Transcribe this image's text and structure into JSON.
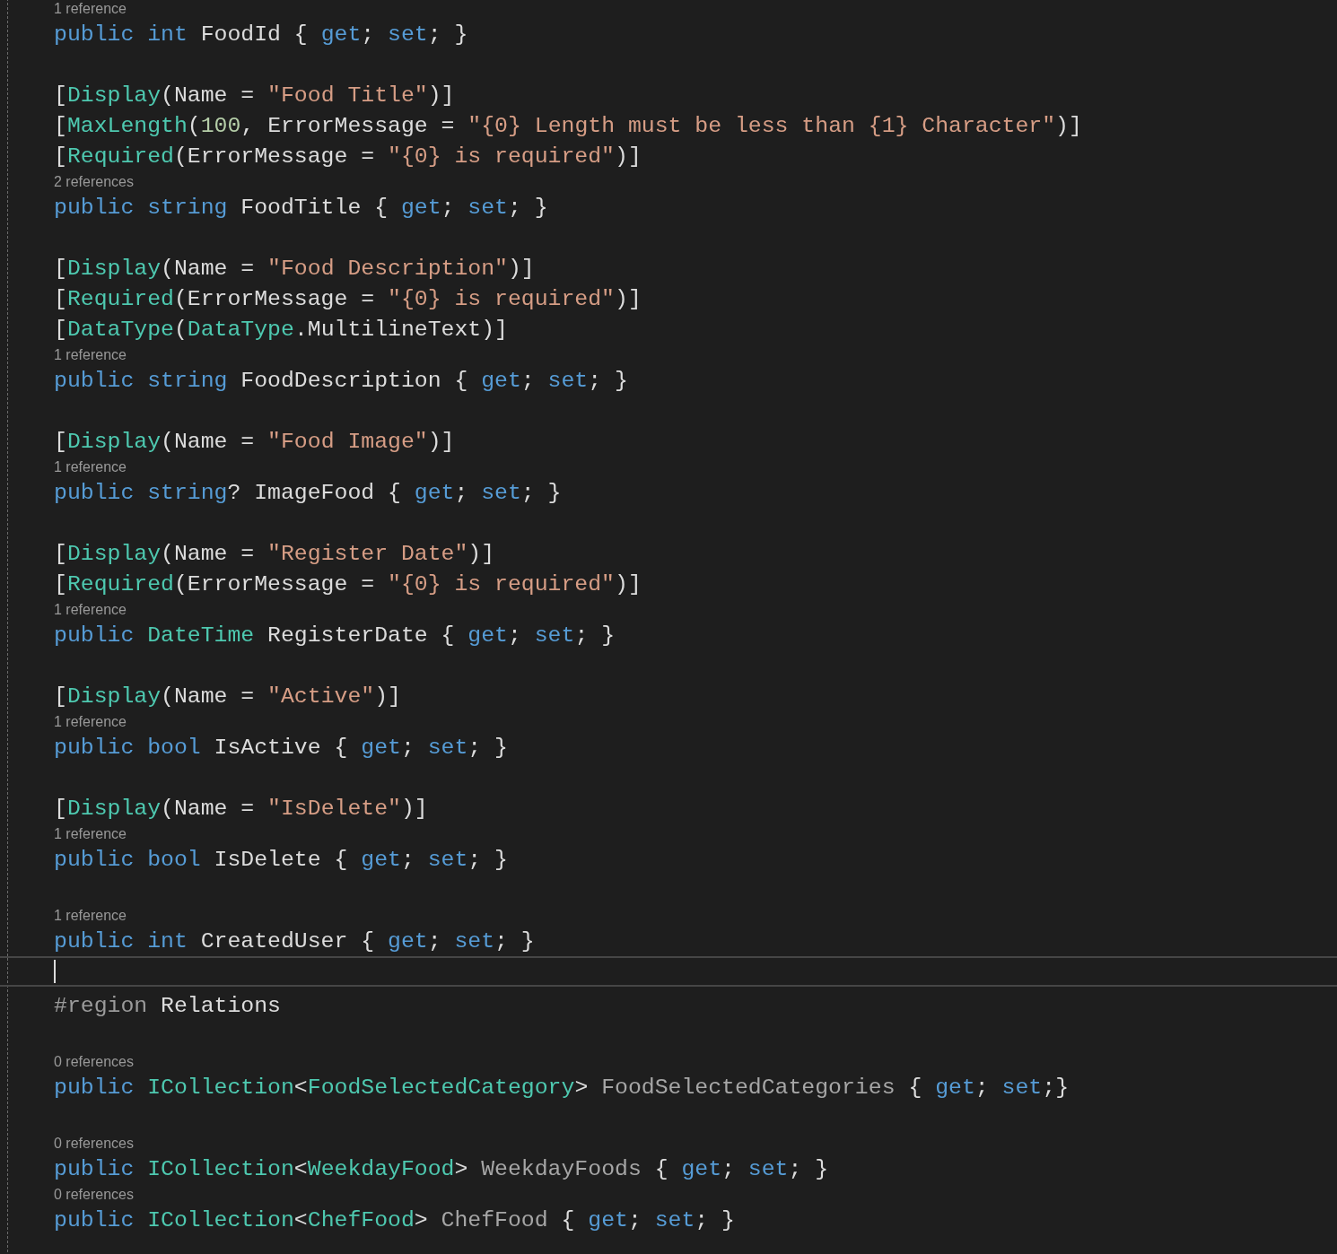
{
  "editor": {
    "lines": [
      {
        "kind": "lens",
        "text": "1 reference"
      },
      {
        "kind": "code",
        "tokens": [
          {
            "kind": "kw",
            "text": "public int"
          },
          {
            "kind": "p",
            "text": " FoodId { "
          },
          {
            "kind": "kw",
            "text": "get"
          },
          {
            "kind": "p",
            "text": "; "
          },
          {
            "kind": "kw",
            "text": "set"
          },
          {
            "kind": "p",
            "text": "; }"
          }
        ]
      },
      {
        "kind": "blank"
      },
      {
        "kind": "code",
        "tokens": [
          {
            "kind": "p",
            "text": "["
          },
          {
            "kind": "attr",
            "text": "Display"
          },
          {
            "kind": "p",
            "text": "(Name = "
          },
          {
            "kind": "str",
            "text": "\"Food Title\""
          },
          {
            "kind": "p",
            "text": ")]"
          }
        ]
      },
      {
        "kind": "code",
        "tokens": [
          {
            "kind": "p",
            "text": "["
          },
          {
            "kind": "attr",
            "text": "MaxLength"
          },
          {
            "kind": "p",
            "text": "("
          },
          {
            "kind": "num",
            "text": "100"
          },
          {
            "kind": "p",
            "text": ", ErrorMessage = "
          },
          {
            "kind": "str",
            "text": "\"{0} Length must be less than {1} Character\""
          },
          {
            "kind": "p",
            "text": ")]"
          }
        ]
      },
      {
        "kind": "code",
        "tokens": [
          {
            "kind": "p",
            "text": "["
          },
          {
            "kind": "attr",
            "text": "Required"
          },
          {
            "kind": "p",
            "text": "(ErrorMessage = "
          },
          {
            "kind": "str",
            "text": "\"{0} is required\""
          },
          {
            "kind": "p",
            "text": ")]"
          }
        ]
      },
      {
        "kind": "lens",
        "text": "2 references"
      },
      {
        "kind": "code",
        "tokens": [
          {
            "kind": "kw",
            "text": "public string"
          },
          {
            "kind": "p",
            "text": " FoodTitle { "
          },
          {
            "kind": "kw",
            "text": "get"
          },
          {
            "kind": "p",
            "text": "; "
          },
          {
            "kind": "kw",
            "text": "set"
          },
          {
            "kind": "p",
            "text": "; }"
          }
        ]
      },
      {
        "kind": "blank"
      },
      {
        "kind": "code",
        "tokens": [
          {
            "kind": "p",
            "text": "["
          },
          {
            "kind": "attr",
            "text": "Display"
          },
          {
            "kind": "p",
            "text": "(Name = "
          },
          {
            "kind": "str",
            "text": "\"Food Description\""
          },
          {
            "kind": "p",
            "text": ")]"
          }
        ]
      },
      {
        "kind": "code",
        "tokens": [
          {
            "kind": "p",
            "text": "["
          },
          {
            "kind": "attr",
            "text": "Required"
          },
          {
            "kind": "p",
            "text": "(ErrorMessage = "
          },
          {
            "kind": "str",
            "text": "\"{0} is required\""
          },
          {
            "kind": "p",
            "text": ")]"
          }
        ]
      },
      {
        "kind": "code",
        "tokens": [
          {
            "kind": "p",
            "text": "["
          },
          {
            "kind": "attr",
            "text": "DataType"
          },
          {
            "kind": "p",
            "text": "("
          },
          {
            "kind": "attr",
            "text": "DataType"
          },
          {
            "kind": "p",
            "text": ".MultilineText)]"
          }
        ]
      },
      {
        "kind": "lens",
        "text": "1 reference"
      },
      {
        "kind": "code",
        "tokens": [
          {
            "kind": "kw",
            "text": "public string"
          },
          {
            "kind": "p",
            "text": " FoodDescription { "
          },
          {
            "kind": "kw",
            "text": "get"
          },
          {
            "kind": "p",
            "text": "; "
          },
          {
            "kind": "kw",
            "text": "set"
          },
          {
            "kind": "p",
            "text": "; }"
          }
        ]
      },
      {
        "kind": "blank"
      },
      {
        "kind": "code",
        "tokens": [
          {
            "kind": "p",
            "text": "["
          },
          {
            "kind": "attr",
            "text": "Display"
          },
          {
            "kind": "p",
            "text": "(Name = "
          },
          {
            "kind": "str",
            "text": "\"Food Image\""
          },
          {
            "kind": "p",
            "text": ")]"
          }
        ]
      },
      {
        "kind": "lens",
        "text": "1 reference"
      },
      {
        "kind": "code",
        "tokens": [
          {
            "kind": "kw",
            "text": "public string"
          },
          {
            "kind": "p",
            "text": "? ImageFood { "
          },
          {
            "kind": "kw",
            "text": "get"
          },
          {
            "kind": "p",
            "text": "; "
          },
          {
            "kind": "kw",
            "text": "set"
          },
          {
            "kind": "p",
            "text": "; }"
          }
        ]
      },
      {
        "kind": "blank"
      },
      {
        "kind": "code",
        "tokens": [
          {
            "kind": "p",
            "text": "["
          },
          {
            "kind": "attr",
            "text": "Display"
          },
          {
            "kind": "p",
            "text": "(Name = "
          },
          {
            "kind": "str",
            "text": "\"Register Date\""
          },
          {
            "kind": "p",
            "text": ")]"
          }
        ]
      },
      {
        "kind": "code",
        "tokens": [
          {
            "kind": "p",
            "text": "["
          },
          {
            "kind": "attr",
            "text": "Required"
          },
          {
            "kind": "p",
            "text": "(ErrorMessage = "
          },
          {
            "kind": "str",
            "text": "\"{0} is required\""
          },
          {
            "kind": "p",
            "text": ")]"
          }
        ]
      },
      {
        "kind": "lens",
        "text": "1 reference"
      },
      {
        "kind": "code",
        "tokens": [
          {
            "kind": "kw",
            "text": "public "
          },
          {
            "kind": "type",
            "text": "DateTime"
          },
          {
            "kind": "p",
            "text": " RegisterDate { "
          },
          {
            "kind": "kw",
            "text": "get"
          },
          {
            "kind": "p",
            "text": "; "
          },
          {
            "kind": "kw",
            "text": "set"
          },
          {
            "kind": "p",
            "text": "; }"
          }
        ]
      },
      {
        "kind": "blank"
      },
      {
        "kind": "code",
        "tokens": [
          {
            "kind": "p",
            "text": "["
          },
          {
            "kind": "attr",
            "text": "Display"
          },
          {
            "kind": "p",
            "text": "(Name = "
          },
          {
            "kind": "str",
            "text": "\"Active\""
          },
          {
            "kind": "p",
            "text": ")]"
          }
        ]
      },
      {
        "kind": "lens",
        "text": "1 reference"
      },
      {
        "kind": "code",
        "tokens": [
          {
            "kind": "kw",
            "text": "public bool"
          },
          {
            "kind": "p",
            "text": " IsActive { "
          },
          {
            "kind": "kw",
            "text": "get"
          },
          {
            "kind": "p",
            "text": "; "
          },
          {
            "kind": "kw",
            "text": "set"
          },
          {
            "kind": "p",
            "text": "; }"
          }
        ]
      },
      {
        "kind": "blank"
      },
      {
        "kind": "code",
        "tokens": [
          {
            "kind": "p",
            "text": "["
          },
          {
            "kind": "attr",
            "text": "Display"
          },
          {
            "kind": "p",
            "text": "(Name = "
          },
          {
            "kind": "str",
            "text": "\"IsDelete\""
          },
          {
            "kind": "p",
            "text": ")]"
          }
        ]
      },
      {
        "kind": "lens",
        "text": "1 reference"
      },
      {
        "kind": "code",
        "tokens": [
          {
            "kind": "kw",
            "text": "public bool"
          },
          {
            "kind": "p",
            "text": " IsDelete { "
          },
          {
            "kind": "kw",
            "text": "get"
          },
          {
            "kind": "p",
            "text": "; "
          },
          {
            "kind": "kw",
            "text": "set"
          },
          {
            "kind": "p",
            "text": "; }"
          }
        ]
      },
      {
        "kind": "blank"
      },
      {
        "kind": "lens",
        "text": "1 reference"
      },
      {
        "kind": "code",
        "tokens": [
          {
            "kind": "kw",
            "text": "public int"
          },
          {
            "kind": "p",
            "text": " CreatedUser { "
          },
          {
            "kind": "kw",
            "text": "get"
          },
          {
            "kind": "p",
            "text": "; "
          },
          {
            "kind": "kw",
            "text": "set"
          },
          {
            "kind": "p",
            "text": "; }"
          }
        ]
      },
      {
        "kind": "caret"
      },
      {
        "kind": "code",
        "tokens": [
          {
            "kind": "region",
            "text": "#region"
          },
          {
            "kind": "p",
            "text": " Relations"
          }
        ]
      },
      {
        "kind": "blank"
      },
      {
        "kind": "lens",
        "text": "0 references"
      },
      {
        "kind": "code",
        "tokens": [
          {
            "kind": "kw",
            "text": "public "
          },
          {
            "kind": "type",
            "text": "ICollection"
          },
          {
            "kind": "p",
            "text": "<"
          },
          {
            "kind": "type",
            "text": "FoodSelectedCategory"
          },
          {
            "kind": "p",
            "text": "> "
          },
          {
            "kind": "unused",
            "text": "FoodSelectedCategories"
          },
          {
            "kind": "p",
            "text": " { "
          },
          {
            "kind": "kw",
            "text": "get"
          },
          {
            "kind": "p",
            "text": "; "
          },
          {
            "kind": "kw",
            "text": "set"
          },
          {
            "kind": "p",
            "text": ";}"
          }
        ]
      },
      {
        "kind": "blank"
      },
      {
        "kind": "lens",
        "text": "0 references"
      },
      {
        "kind": "code",
        "tokens": [
          {
            "kind": "kw",
            "text": "public "
          },
          {
            "kind": "type",
            "text": "ICollection"
          },
          {
            "kind": "p",
            "text": "<"
          },
          {
            "kind": "type",
            "text": "WeekdayFood"
          },
          {
            "kind": "p",
            "text": "> "
          },
          {
            "kind": "unused",
            "text": "WeekdayFoods"
          },
          {
            "kind": "p",
            "text": " { "
          },
          {
            "kind": "kw",
            "text": "get"
          },
          {
            "kind": "p",
            "text": "; "
          },
          {
            "kind": "kw",
            "text": "set"
          },
          {
            "kind": "p",
            "text": "; }"
          }
        ]
      },
      {
        "kind": "lens",
        "text": "0 references"
      },
      {
        "kind": "code",
        "tokens": [
          {
            "kind": "kw",
            "text": "public "
          },
          {
            "kind": "type",
            "text": "ICollection"
          },
          {
            "kind": "p",
            "text": "<"
          },
          {
            "kind": "type",
            "text": "ChefFood"
          },
          {
            "kind": "p",
            "text": "> "
          },
          {
            "kind": "unused",
            "text": "ChefFood"
          },
          {
            "kind": "p",
            "text": " { "
          },
          {
            "kind": "kw",
            "text": "get"
          },
          {
            "kind": "p",
            "text": "; "
          },
          {
            "kind": "kw",
            "text": "set"
          },
          {
            "kind": "p",
            "text": "; }"
          }
        ]
      }
    ]
  }
}
